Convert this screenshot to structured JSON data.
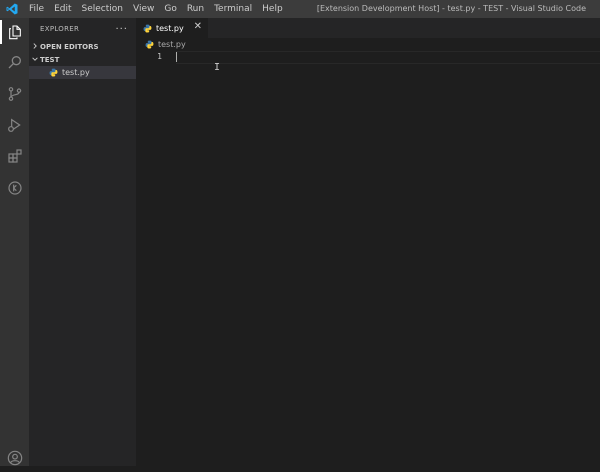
{
  "titlebar": {
    "menu": [
      "File",
      "Edit",
      "Selection",
      "View",
      "Go",
      "Run",
      "Terminal",
      "Help"
    ],
    "window_title": "[Extension Development Host] - test.py - TEST - Visual Studio Code"
  },
  "activitybar": {
    "icons": [
      "explorer-icon",
      "search-icon",
      "source-control-icon",
      "run-debug-icon",
      "extensions-icon",
      "remote-icon",
      "account-icon"
    ]
  },
  "sidebar": {
    "title": "EXPLORER",
    "more": "···",
    "sections": [
      {
        "label": "OPEN EDITORS",
        "expanded": false
      },
      {
        "label": "TEST",
        "expanded": true
      }
    ],
    "files": [
      {
        "label": "test.py",
        "selected": true
      }
    ]
  },
  "editor": {
    "tab": {
      "label": "test.py",
      "close": "✕"
    },
    "breadcrumb": "test.py",
    "line_number": "1"
  },
  "colors": {
    "titlebar": "#3c3c3c",
    "activitybar": "#333333",
    "sidebar": "#252526",
    "editor": "#1e1e1e",
    "vscode_blue": "#23a9f2",
    "python_blue": "#3c78aa",
    "python_yellow": "#ffd43b"
  }
}
